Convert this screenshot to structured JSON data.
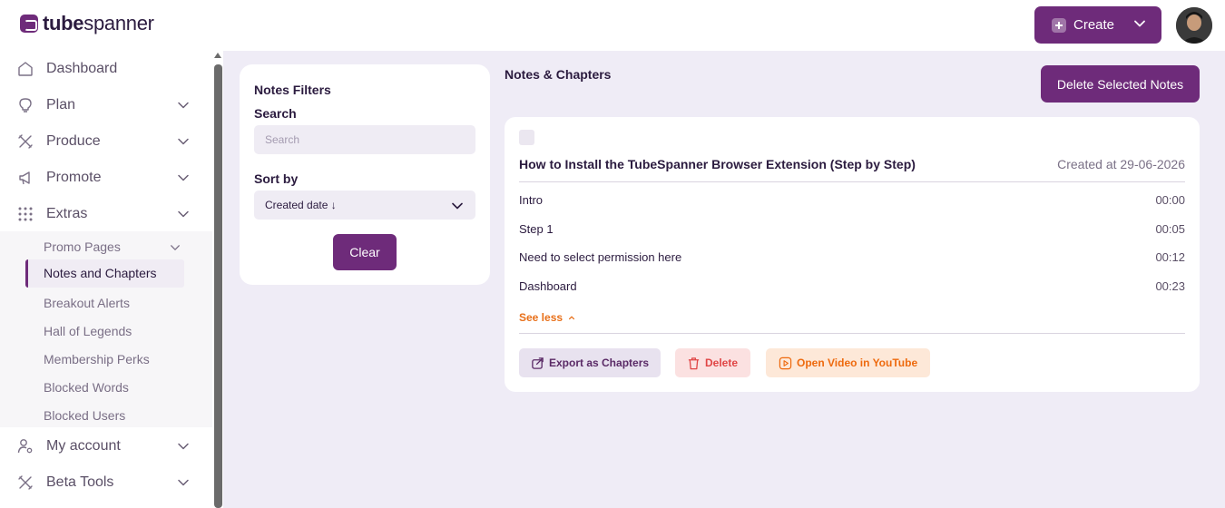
{
  "header": {
    "logo_bold": "tube",
    "logo_light": "spanner",
    "create_label": "Create"
  },
  "sidebar": {
    "items": [
      {
        "label": "Dashboard",
        "icon": "home-icon"
      },
      {
        "label": "Plan",
        "icon": "lightbulb-icon"
      },
      {
        "label": "Produce",
        "icon": "tools-icon"
      },
      {
        "label": "Promote",
        "icon": "megaphone-icon"
      },
      {
        "label": "Extras",
        "icon": "grid-dots-icon"
      }
    ],
    "extras_sub": [
      {
        "label": "Promo Pages"
      },
      {
        "label": "Notes and Chapters"
      },
      {
        "label": "Breakout Alerts"
      },
      {
        "label": "Hall of Legends"
      },
      {
        "label": "Membership Perks"
      },
      {
        "label": "Blocked Words"
      },
      {
        "label": "Blocked Users"
      }
    ],
    "bottom_items": [
      {
        "label": "My account",
        "icon": "user-gear-icon"
      },
      {
        "label": "Beta Tools",
        "icon": "tools-icon"
      }
    ]
  },
  "filters": {
    "title": "Notes Filters",
    "search_label": "Search",
    "search_placeholder": "Search",
    "search_value": "",
    "sort_label": "Sort by",
    "sort_value": "Created date ↓",
    "clear_label": "Clear"
  },
  "notes": {
    "title": "Notes & Chapters",
    "delete_selected_label": "Delete Selected Notes",
    "card": {
      "title": "How to Install the TubeSpanner Browser Extension (Step by Step)",
      "created": "Created at 29-06-2026",
      "chapters": [
        {
          "title": "Intro",
          "time": "00:00"
        },
        {
          "title": "Step 1",
          "time": "00:05"
        },
        {
          "title": "Need to select permission here",
          "time": "00:12"
        },
        {
          "title": "Dashboard",
          "time": "00:23"
        }
      ],
      "see_less_label": "See less",
      "actions": {
        "export_label": "Export as Chapters",
        "delete_label": "Delete",
        "youtube_label": "Open Video in YouTube"
      }
    }
  },
  "colors": {
    "brand": "#6e2b7a",
    "main_bg": "#efecf6",
    "orange": "#e8701a",
    "red": "#e04545"
  }
}
